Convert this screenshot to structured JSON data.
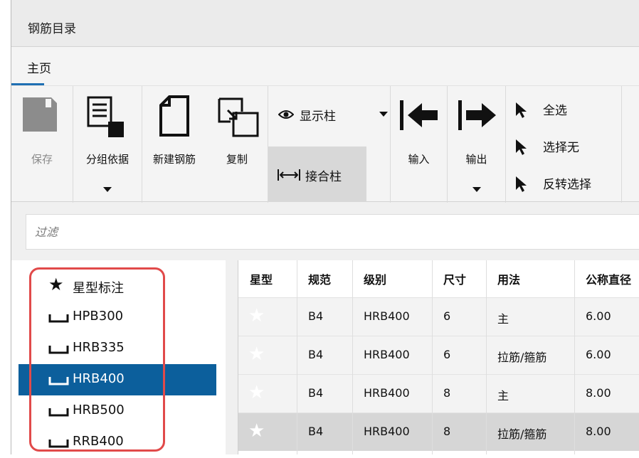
{
  "window": {
    "title": "钢筋目录"
  },
  "tabs": [
    {
      "label": "主页"
    }
  ],
  "ribbon": {
    "save": "保存",
    "group_by": "分组依据",
    "new_rebar": "新建钢筋",
    "copy": "复制",
    "show_columns": "显示柱",
    "joint_columns": "接合柱",
    "import": "输入",
    "export": "输出",
    "select_all": "全选",
    "select_none": "选择无",
    "invert_selection": "反转选择"
  },
  "filter": {
    "placeholder": "过滤"
  },
  "sidebar": {
    "items": [
      {
        "label": "星型标注",
        "icon": "star-icon"
      },
      {
        "label": "HPB300",
        "icon": "rebar-hook-icon"
      },
      {
        "label": "HRB335",
        "icon": "rebar-hook-icon"
      },
      {
        "label": "HRB400",
        "icon": "rebar-hook-icon",
        "selected": true
      },
      {
        "label": "HRB500",
        "icon": "rebar-hook-icon"
      },
      {
        "label": "RRB400",
        "icon": "rebar-hook-icon"
      }
    ]
  },
  "table": {
    "columns": [
      "星型",
      "规范",
      "级别",
      "尺寸",
      "用法",
      "公称直径"
    ],
    "rows": [
      {
        "spec": "B4",
        "grade": "HRB400",
        "size": "6",
        "usage": "主",
        "diameter": "6.00"
      },
      {
        "spec": "B4",
        "grade": "HRB400",
        "size": "6",
        "usage": "拉筋/箍筋",
        "diameter": "6.00"
      },
      {
        "spec": "B4",
        "grade": "HRB400",
        "size": "8",
        "usage": "主",
        "diameter": "8.00"
      },
      {
        "spec": "B4",
        "grade": "HRB400",
        "size": "8",
        "usage": "拉筋/箍筋",
        "diameter": "8.00"
      }
    ]
  },
  "colors": {
    "accent": "#0c5f9c",
    "highlight": "#e14a4a",
    "tab_underline": "#1f6fb3"
  }
}
